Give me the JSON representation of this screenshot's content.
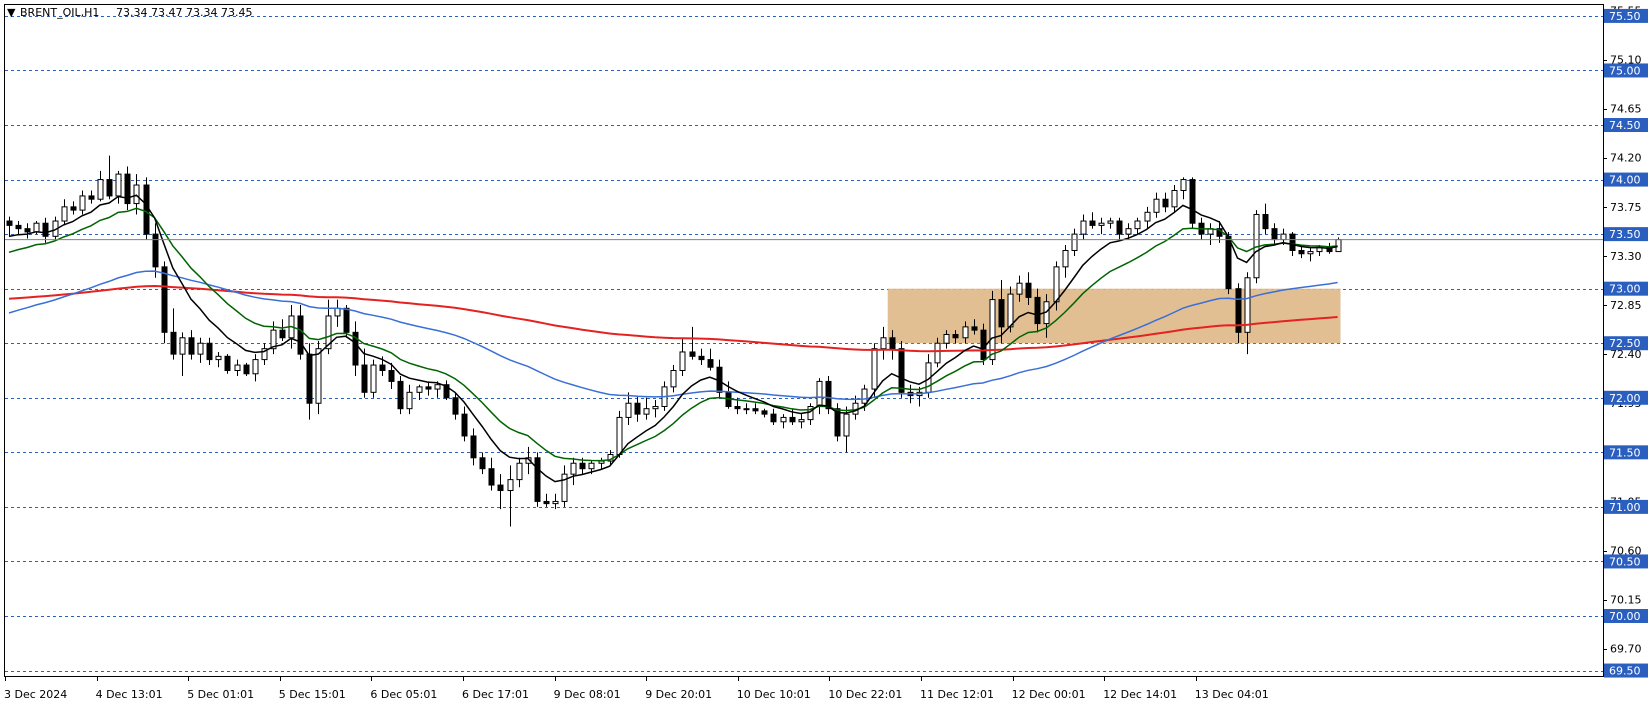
{
  "chart_data": {
    "type": "candlestick",
    "title": "BRENT_OIL,H1",
    "ohlc_label": "73.34 73.47 73.34 73.45",
    "header_arrow": "▼",
    "current_price": "73.45",
    "ylim": [
      69.45,
      75.6
    ],
    "grid": false,
    "y_ticks": [
      "75.55",
      "75.10",
      "74.65",
      "74.20",
      "73.75",
      "73.30",
      "72.85",
      "72.40",
      "71.95",
      "71.05",
      "70.60",
      "70.15",
      "69.70"
    ],
    "level_lines": [
      {
        "value": 75.5,
        "label": "75.50"
      },
      {
        "value": 75.0,
        "label": "75.00"
      },
      {
        "value": 74.5,
        "label": "74.50"
      },
      {
        "value": 74.0,
        "label": "74.00"
      },
      {
        "value": 73.5,
        "label": "73.50"
      },
      {
        "value": 73.0,
        "label": "73.00"
      },
      {
        "value": 72.5,
        "label": "72.50"
      },
      {
        "value": 72.0,
        "label": "72.00"
      },
      {
        "value": 71.5,
        "label": "71.50"
      },
      {
        "value": 71.0,
        "label": "71.00"
      },
      {
        "value": 70.5,
        "label": "70.50"
      },
      {
        "value": 70.0,
        "label": "70.00"
      },
      {
        "value": 69.5,
        "label": "69.50"
      }
    ],
    "x_labels": [
      "3 Dec 2024",
      "4 Dec 13:01",
      "5 Dec 01:01",
      "5 Dec 15:01",
      "6 Dec 05:01",
      "6 Dec 17:01",
      "9 Dec 08:01",
      "9 Dec 20:01",
      "10 Dec 10:01",
      "10 Dec 22:01",
      "11 Dec 12:01",
      "12 Dec 00:01",
      "12 Dec 14:01",
      "13 Dec 04:01"
    ],
    "zone": {
      "from_bar": 97,
      "to_bar": 145,
      "low": 72.5,
      "high": 73.0,
      "color": "#deb887"
    },
    "colors": {
      "bull": "#ffffff",
      "bear": "#000000",
      "outline": "#000000",
      "level": "#2b5fbf",
      "badge": "#2b5fbf",
      "ma_black": "#000000",
      "ma_green": "#006400",
      "ma_blue": "#3a6fd8",
      "ma_red": "#e52222"
    },
    "candles": [
      [
        73.62,
        73.66,
        73.48,
        73.58
      ],
      [
        73.58,
        73.62,
        73.5,
        73.55
      ],
      [
        73.55,
        73.6,
        73.46,
        73.52
      ],
      [
        73.52,
        73.62,
        73.5,
        73.6
      ],
      [
        73.6,
        73.65,
        73.42,
        73.48
      ],
      [
        73.48,
        73.66,
        73.44,
        73.62
      ],
      [
        73.62,
        73.82,
        73.58,
        73.75
      ],
      [
        73.75,
        73.8,
        73.68,
        73.72
      ],
      [
        73.72,
        73.9,
        73.68,
        73.85
      ],
      [
        73.85,
        73.9,
        73.78,
        73.82
      ],
      [
        73.82,
        74.08,
        73.8,
        74.0
      ],
      [
        74.0,
        74.22,
        73.82,
        73.85
      ],
      [
        73.85,
        74.08,
        73.78,
        74.05
      ],
      [
        74.05,
        74.12,
        73.72,
        73.78
      ],
      [
        73.78,
        74.05,
        73.68,
        73.95
      ],
      [
        73.95,
        74.02,
        73.45,
        73.5
      ],
      [
        73.5,
        73.6,
        73.1,
        73.2
      ],
      [
        73.2,
        73.25,
        72.5,
        72.6
      ],
      [
        72.6,
        72.82,
        72.35,
        72.4
      ],
      [
        72.4,
        72.6,
        72.2,
        72.55
      ],
      [
        72.55,
        72.62,
        72.35,
        72.4
      ],
      [
        72.4,
        72.55,
        72.32,
        72.5
      ],
      [
        72.5,
        72.55,
        72.3,
        72.35
      ],
      [
        72.35,
        72.42,
        72.28,
        72.38
      ],
      [
        72.38,
        72.4,
        72.22,
        72.25
      ],
      [
        72.25,
        72.35,
        72.2,
        72.3
      ],
      [
        72.3,
        72.32,
        72.2,
        72.22
      ],
      [
        72.22,
        72.4,
        72.15,
        72.35
      ],
      [
        72.35,
        72.5,
        72.3,
        72.45
      ],
      [
        72.45,
        72.7,
        72.4,
        72.62
      ],
      [
        72.62,
        72.72,
        72.52,
        72.55
      ],
      [
        72.55,
        72.85,
        72.45,
        72.75
      ],
      [
        72.75,
        72.85,
        72.35,
        72.4
      ],
      [
        72.4,
        72.5,
        71.8,
        71.95
      ],
      [
        71.95,
        72.52,
        71.85,
        72.45
      ],
      [
        72.45,
        72.9,
        72.4,
        72.75
      ],
      [
        72.75,
        72.9,
        72.65,
        72.82
      ],
      [
        72.82,
        72.85,
        72.55,
        72.6
      ],
      [
        72.6,
        72.7,
        72.2,
        72.3
      ],
      [
        72.3,
        72.45,
        72.0,
        72.05
      ],
      [
        72.05,
        72.35,
        72.0,
        72.3
      ],
      [
        72.3,
        72.38,
        72.2,
        72.25
      ],
      [
        72.25,
        72.32,
        72.08,
        72.15
      ],
      [
        72.15,
        72.2,
        71.85,
        71.9
      ],
      [
        71.9,
        72.12,
        71.85,
        72.05
      ],
      [
        72.05,
        72.12,
        71.98,
        72.1
      ],
      [
        72.1,
        72.15,
        72.02,
        72.08
      ],
      [
        72.08,
        72.15,
        72.0,
        72.12
      ],
      [
        72.12,
        72.16,
        71.98,
        72.0
      ],
      [
        72.0,
        72.05,
        71.8,
        71.85
      ],
      [
        71.85,
        71.92,
        71.6,
        71.65
      ],
      [
        71.65,
        71.72,
        71.38,
        71.45
      ],
      [
        71.45,
        71.5,
        71.3,
        71.35
      ],
      [
        71.35,
        71.45,
        71.15,
        71.2
      ],
      [
        71.2,
        71.3,
        70.98,
        71.15
      ],
      [
        71.15,
        71.38,
        70.82,
        71.25
      ],
      [
        71.25,
        71.45,
        71.18,
        71.4
      ],
      [
        71.4,
        71.55,
        71.3,
        71.45
      ],
      [
        71.45,
        71.5,
        71.0,
        71.05
      ],
      [
        71.05,
        71.12,
        71.0,
        71.03
      ],
      [
        71.03,
        71.12,
        70.98,
        71.05
      ],
      [
        71.05,
        71.38,
        71.0,
        71.3
      ],
      [
        71.3,
        71.45,
        71.2,
        71.4
      ],
      [
        71.4,
        71.45,
        71.3,
        71.35
      ],
      [
        71.35,
        71.42,
        71.3,
        71.4
      ],
      [
        71.4,
        71.45,
        71.35,
        71.42
      ],
      [
        71.42,
        71.52,
        71.38,
        71.48
      ],
      [
        71.48,
        71.88,
        71.45,
        71.82
      ],
      [
        71.82,
        72.05,
        71.75,
        71.95
      ],
      [
        71.95,
        72.02,
        71.78,
        71.85
      ],
      [
        71.85,
        72.0,
        71.8,
        71.9
      ],
      [
        71.9,
        71.98,
        71.82,
        71.92
      ],
      [
        71.92,
        72.15,
        71.88,
        72.1
      ],
      [
        72.1,
        72.3,
        72.05,
        72.25
      ],
      [
        72.25,
        72.55,
        72.2,
        72.42
      ],
      [
        72.42,
        72.65,
        72.35,
        72.38
      ],
      [
        72.38,
        72.45,
        72.3,
        72.35
      ],
      [
        72.35,
        72.45,
        72.25,
        72.28
      ],
      [
        72.28,
        72.35,
        72.0,
        72.05
      ],
      [
        72.05,
        72.15,
        71.9,
        71.92
      ],
      [
        71.92,
        72.0,
        71.85,
        71.9
      ],
      [
        71.9,
        71.95,
        71.85,
        71.9
      ],
      [
        71.9,
        71.95,
        71.85,
        71.88
      ],
      [
        71.88,
        71.9,
        71.82,
        71.85
      ],
      [
        71.85,
        71.9,
        71.75,
        71.78
      ],
      [
        71.78,
        71.85,
        71.72,
        71.82
      ],
      [
        71.82,
        71.9,
        71.75,
        71.78
      ],
      [
        71.78,
        71.85,
        71.72,
        71.8
      ],
      [
        71.8,
        71.95,
        71.75,
        71.92
      ],
      [
        71.92,
        72.18,
        71.85,
        72.15
      ],
      [
        72.15,
        72.2,
        71.85,
        71.9
      ],
      [
        71.9,
        71.95,
        71.6,
        71.65
      ],
      [
        71.65,
        71.92,
        71.5,
        71.85
      ],
      [
        71.85,
        72.02,
        71.8,
        71.95
      ],
      [
        71.95,
        72.12,
        71.88,
        72.08
      ],
      [
        72.08,
        72.5,
        72.0,
        72.45
      ],
      [
        72.45,
        72.65,
        72.35,
        72.55
      ],
      [
        72.55,
        72.62,
        72.35,
        72.45
      ],
      [
        72.45,
        72.52,
        72.0,
        72.05
      ],
      [
        72.05,
        72.12,
        71.95,
        72.02
      ],
      [
        72.02,
        72.1,
        71.92,
        72.05
      ],
      [
        72.05,
        72.4,
        72.0,
        72.32
      ],
      [
        72.32,
        72.55,
        72.28,
        72.5
      ],
      [
        72.5,
        72.62,
        72.45,
        72.58
      ],
      [
        72.58,
        72.62,
        72.5,
        72.55
      ],
      [
        72.55,
        72.7,
        72.5,
        72.65
      ],
      [
        72.65,
        72.72,
        72.58,
        72.62
      ],
      [
        72.62,
        72.68,
        72.3,
        72.35
      ],
      [
        72.35,
        72.98,
        72.3,
        72.9
      ],
      [
        72.9,
        73.08,
        72.5,
        72.65
      ],
      [
        72.65,
        73.02,
        72.6,
        72.95
      ],
      [
        72.95,
        73.12,
        72.88,
        73.05
      ],
      [
        73.05,
        73.15,
        72.85,
        72.92
      ],
      [
        72.92,
        73.0,
        72.6,
        72.68
      ],
      [
        72.68,
        72.95,
        72.55,
        72.88
      ],
      [
        72.88,
        73.25,
        72.8,
        73.2
      ],
      [
        73.2,
        73.4,
        73.1,
        73.35
      ],
      [
        73.35,
        73.55,
        73.3,
        73.5
      ],
      [
        73.5,
        73.68,
        73.45,
        73.62
      ],
      [
        73.62,
        73.7,
        73.55,
        73.58
      ],
      [
        73.58,
        73.65,
        73.5,
        73.6
      ],
      [
        73.6,
        73.65,
        73.55,
        73.62
      ],
      [
        73.62,
        73.65,
        73.45,
        73.5
      ],
      [
        73.5,
        73.6,
        73.45,
        73.55
      ],
      [
        73.55,
        73.65,
        73.5,
        73.62
      ],
      [
        73.62,
        73.75,
        73.55,
        73.7
      ],
      [
        73.7,
        73.88,
        73.65,
        73.82
      ],
      [
        73.82,
        73.88,
        73.7,
        73.75
      ],
      [
        73.75,
        73.95,
        73.7,
        73.9
      ],
      [
        73.9,
        74.02,
        73.82,
        74.0
      ],
      [
        74.0,
        74.02,
        73.55,
        73.6
      ],
      [
        73.6,
        73.65,
        73.45,
        73.5
      ],
      [
        73.5,
        73.6,
        73.4,
        73.55
      ],
      [
        73.55,
        73.62,
        73.42,
        73.48
      ],
      [
        73.48,
        73.52,
        72.95,
        73.0
      ],
      [
        73.0,
        73.05,
        72.5,
        72.6
      ],
      [
        72.6,
        73.15,
        72.4,
        73.1
      ],
      [
        73.1,
        73.72,
        73.05,
        73.68
      ],
      [
        73.68,
        73.78,
        73.5,
        73.55
      ],
      [
        73.55,
        73.6,
        73.4,
        73.45
      ],
      [
        73.45,
        73.55,
        73.4,
        73.5
      ],
      [
        73.5,
        73.52,
        73.3,
        73.35
      ],
      [
        73.35,
        73.4,
        73.28,
        73.32
      ],
      [
        73.32,
        73.38,
        73.25,
        73.34
      ],
      [
        73.34,
        73.4,
        73.3,
        73.38
      ],
      [
        73.38,
        73.42,
        73.32,
        73.34
      ],
      [
        73.34,
        73.47,
        73.34,
        73.45
      ]
    ]
  }
}
